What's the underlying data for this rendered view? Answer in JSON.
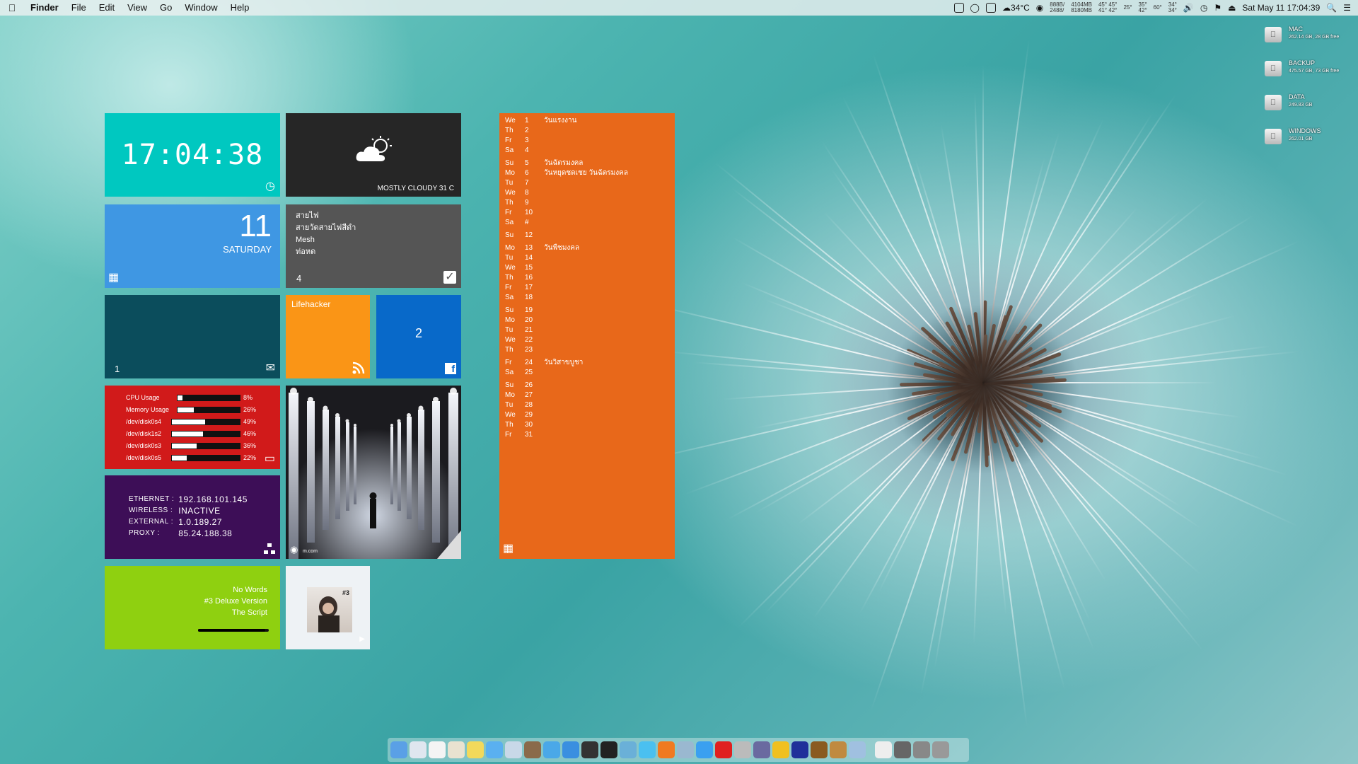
{
  "menubar": {
    "apple_icon": "apple-logo-icon",
    "app_name": "Finder",
    "menus": [
      "File",
      "Edit",
      "View",
      "Go",
      "Window",
      "Help"
    ],
    "status": {
      "weather_temp": "34°C",
      "net_tx": "888B/",
      "net_rx": "2488/",
      "mem_used": "4104MB",
      "mem_free": "8180MB",
      "cpu_temp_a": "45°",
      "cpu_temp_b": "41°",
      "cpu_temp_c": "45°",
      "cpu_temp_d": "42°",
      "temp_1": "25°",
      "temp_2": "35°",
      "temp_3": "42°",
      "temp_4": "60°",
      "temp_5": "34°",
      "temp_6": "34°",
      "datetime": "Sat May 11 17:04:39"
    }
  },
  "tiles": {
    "clock": {
      "time": "17:04:38",
      "icon": "clock-icon"
    },
    "weather": {
      "description": "MOSTLY CLOUDY 31 C",
      "icon": "cloud-sun-icon"
    },
    "date": {
      "day": "11",
      "weekday": "SATURDAY",
      "icon": "calendar-icon"
    },
    "todo": {
      "items": [
        "สายไฟ",
        "สายวัดสายไฟสีดำ",
        "Mesh",
        "ท่อหด"
      ],
      "count": "4",
      "icon": "checkbox-icon"
    },
    "mail": {
      "count": "1",
      "icon": "envelope-icon"
    },
    "rss": {
      "name": "Lifehacker",
      "icon": "rss-icon"
    },
    "facebook": {
      "count": "2",
      "icon": "facebook-icon"
    },
    "system": {
      "rows": [
        {
          "label": "CPU Usage",
          "percent": "8%",
          "value": 0.08
        },
        {
          "label": "Memory Usage",
          "percent": "26%",
          "value": 0.26
        },
        {
          "label": "/dev/disk0s4",
          "percent": "49%",
          "value": 0.49
        },
        {
          "label": "/dev/disk1s2",
          "percent": "46%",
          "value": 0.46
        },
        {
          "label": "/dev/disk0s3",
          "percent": "36%",
          "value": 0.36
        },
        {
          "label": "/dev/disk0s5",
          "percent": "22%",
          "value": 0.22
        }
      ],
      "icon": "monitor-icon"
    },
    "network": {
      "rows": [
        {
          "label": "ETHERNET :",
          "value": "192.168.101.145"
        },
        {
          "label": "WIRELESS :",
          "value": "INACTIVE"
        },
        {
          "label": "EXTERNAL :",
          "value": "1.0.189.27"
        },
        {
          "label": "PROXY    :",
          "value": "85.24.188.38"
        }
      ],
      "icon": "network-icon"
    },
    "photo": {
      "icon": "camera-icon",
      "caption": "m.com"
    },
    "music": {
      "track": "No Words",
      "album": "#3 Deluxe Version",
      "artist": "The Script",
      "progress": 0.95
    },
    "album": {
      "cover_text": "#3",
      "icon": "play-icon"
    }
  },
  "calendar": {
    "icon": "calendar-icon",
    "days": [
      {
        "dow": "We",
        "day": "1",
        "event": "วันแรงงาน"
      },
      {
        "dow": "Th",
        "day": "2",
        "event": ""
      },
      {
        "dow": "Fr",
        "day": "3",
        "event": ""
      },
      {
        "dow": "Sa",
        "day": "4",
        "event": ""
      },
      {
        "dow": "Su",
        "day": "5",
        "event": "วันฉัตรมงคล"
      },
      {
        "dow": "Mo",
        "day": "6",
        "event": "วันหยุดชดเชย วันฉัตรมงคล"
      },
      {
        "dow": "Tu",
        "day": "7",
        "event": ""
      },
      {
        "dow": "We",
        "day": "8",
        "event": ""
      },
      {
        "dow": "Th",
        "day": "9",
        "event": ""
      },
      {
        "dow": "Fr",
        "day": "10",
        "event": ""
      },
      {
        "dow": "Sa",
        "day": "#",
        "event": ""
      },
      {
        "dow": "Su",
        "day": "12",
        "event": ""
      },
      {
        "dow": "Mo",
        "day": "13",
        "event": "วันพืชมงคล"
      },
      {
        "dow": "Tu",
        "day": "14",
        "event": ""
      },
      {
        "dow": "We",
        "day": "15",
        "event": ""
      },
      {
        "dow": "Th",
        "day": "16",
        "event": ""
      },
      {
        "dow": "Fr",
        "day": "17",
        "event": ""
      },
      {
        "dow": "Sa",
        "day": "18",
        "event": ""
      },
      {
        "dow": "Su",
        "day": "19",
        "event": ""
      },
      {
        "dow": "Mo",
        "day": "20",
        "event": ""
      },
      {
        "dow": "Tu",
        "day": "21",
        "event": ""
      },
      {
        "dow": "We",
        "day": "22",
        "event": ""
      },
      {
        "dow": "Th",
        "day": "23",
        "event": ""
      },
      {
        "dow": "Fr",
        "day": "24",
        "event": "วันวิสาขบูชา"
      },
      {
        "dow": "Sa",
        "day": "25",
        "event": ""
      },
      {
        "dow": "Su",
        "day": "26",
        "event": ""
      },
      {
        "dow": "Mo",
        "day": "27",
        "event": ""
      },
      {
        "dow": "Tu",
        "day": "28",
        "event": ""
      },
      {
        "dow": "We",
        "day": "29",
        "event": ""
      },
      {
        "dow": "Th",
        "day": "30",
        "event": ""
      },
      {
        "dow": "Fr",
        "day": "31",
        "event": ""
      }
    ]
  },
  "drives": [
    {
      "name": "MAC",
      "size": "262.14 GB, 28 GB free"
    },
    {
      "name": "BACKUP",
      "size": "475.57 GB, 73 GB free"
    },
    {
      "name": "DATA",
      "size": "249.83 GB"
    },
    {
      "name": "WINDOWS",
      "size": "262.01 GB"
    }
  ],
  "dock": {
    "apps": [
      "finder",
      "preview",
      "calendar",
      "textedit",
      "stickies",
      "messages",
      "mail",
      "imovie",
      "itunes",
      "app-store",
      "photo-booth",
      "terminal",
      "network-utility",
      "safari",
      "firefox",
      "mail-bird",
      "twitter",
      "opera",
      "disk-utility",
      "unknown",
      "chrome",
      "blue-app",
      "stuffit",
      "archive",
      "image-editor",
      "text-editor",
      "settings",
      "downloads",
      "trash"
    ]
  },
  "colors": {
    "clock": "#00c8c0",
    "weather": "#262626",
    "date": "#3f97e3",
    "todo": "#555555",
    "mail": "#0b4d5c",
    "rss": "#fa9516",
    "facebook": "#0869c9",
    "system": "#d11a1a",
    "network": "#3d0e57",
    "music": "#8fd010",
    "calendar": "#e8681a"
  }
}
